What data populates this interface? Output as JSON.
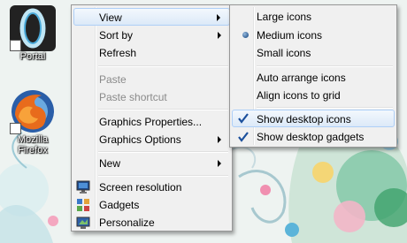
{
  "desktop": {
    "icons": [
      {
        "label": "Portal"
      },
      {
        "label": "Mozilla Firefox"
      }
    ]
  },
  "context_menu": {
    "items": {
      "view": "View",
      "sort_by": "Sort by",
      "refresh": "Refresh",
      "paste": "Paste",
      "paste_shortcut": "Paste shortcut",
      "graphics_properties": "Graphics Properties...",
      "graphics_options": "Graphics Options",
      "new": "New",
      "screen_resolution": "Screen resolution",
      "gadgets": "Gadgets",
      "personalize": "Personalize"
    }
  },
  "view_submenu": {
    "items": {
      "large_icons": "Large icons",
      "medium_icons": "Medium icons",
      "small_icons": "Small icons",
      "auto_arrange": "Auto arrange icons",
      "align_grid": "Align icons to grid",
      "show_desktop_icons": "Show desktop icons",
      "show_desktop_gadgets": "Show desktop gadgets"
    },
    "selected_size": "Medium icons",
    "checked": [
      "Show desktop icons",
      "Show desktop gadgets"
    ]
  },
  "colors": {
    "highlight_border": "#aecff7",
    "disabled_text": "#8a8a8a",
    "check_blue": "#1a4f9c"
  }
}
